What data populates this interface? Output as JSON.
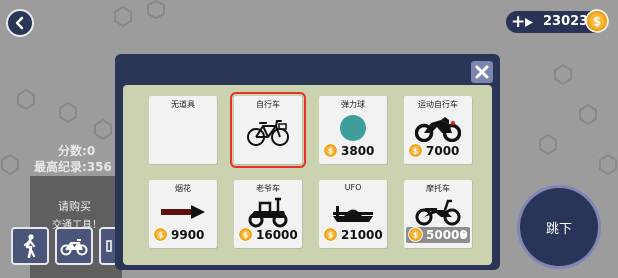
{
  "coins": {
    "amount": "23023",
    "plus": "+"
  },
  "score": {
    "label": "分数:",
    "value": "0"
  },
  "record": {
    "label": "最高纪录:",
    "value": "356"
  },
  "side_panel": {
    "line1": "请购买",
    "line2": "交通工具！"
  },
  "jump_button": {
    "label": "跳下"
  },
  "shop": {
    "items": [
      {
        "name": "无道具",
        "price": "",
        "icon": "none"
      },
      {
        "name": "自行车",
        "price": "",
        "icon": "bicycle",
        "selected": true
      },
      {
        "name": "弹力球",
        "price": "3800",
        "icon": "ball"
      },
      {
        "name": "运动自行车",
        "price": "7000",
        "icon": "sport-motorbike"
      },
      {
        "name": "烟花",
        "price": "9900",
        "icon": "firework-rocket"
      },
      {
        "name": "老爷车",
        "price": "16000",
        "icon": "mobility-scooter"
      },
      {
        "name": "UFO",
        "price": "21000",
        "icon": "ufo"
      },
      {
        "name": "摩托车",
        "price": "50000",
        "icon": "motorcycle"
      }
    ]
  },
  "colors": {
    "panel": "#2b3556",
    "grid": "#cbd2b0",
    "selected": "#e8322a",
    "coin": "#f2a21b",
    "ball": "#3f9e9a"
  }
}
